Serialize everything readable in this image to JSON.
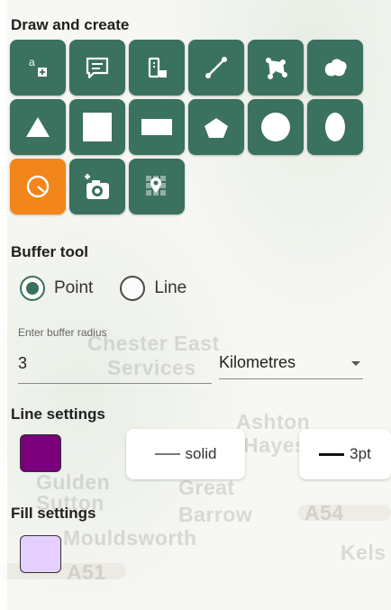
{
  "sections": {
    "draw_title": "Draw and create",
    "buffer_title": "Buffer tool",
    "line_title": "Line settings",
    "fill_title": "Fill settings"
  },
  "draw_tools": [
    {
      "icon": "add-text-icon",
      "active": false
    },
    {
      "icon": "speech-bubble-icon",
      "active": false
    },
    {
      "icon": "add-note-icon",
      "active": false
    },
    {
      "icon": "draw-line-icon",
      "active": false
    },
    {
      "icon": "polygon-icon",
      "active": false
    },
    {
      "icon": "freehand-shape-icon",
      "active": false
    },
    {
      "icon": "triangle-icon",
      "active": false
    },
    {
      "icon": "square-icon",
      "active": false
    },
    {
      "icon": "rectangle-icon",
      "active": false
    },
    {
      "icon": "pentagon-icon",
      "active": false
    },
    {
      "icon": "circle-icon",
      "active": false
    },
    {
      "icon": "ellipse-icon",
      "active": false
    },
    {
      "icon": "buffer-radius-icon",
      "active": true
    },
    {
      "icon": "add-photo-icon",
      "active": false
    },
    {
      "icon": "grid-marker-icon",
      "active": false
    }
  ],
  "buffer": {
    "options": [
      {
        "label": "Point",
        "checked": true
      },
      {
        "label": "Line",
        "checked": false
      }
    ],
    "radius_label": "Enter buffer radius",
    "radius_value": "3",
    "unit": "Kilometres"
  },
  "line_settings": {
    "color": "#7b007b",
    "style_label": "solid",
    "width_label": "3pt"
  },
  "fill_settings": {
    "color": "#e4cfff"
  },
  "map_labels": [
    "Chester East",
    "Services",
    "Ashton",
    "Hayes",
    "Gulden",
    "Sutton",
    "Great",
    "Barrow",
    "Mouldsworth",
    "A51",
    "A54",
    "Kels"
  ],
  "colors": {
    "tool_button": "#3a715f",
    "tool_active": "#f2861a"
  }
}
